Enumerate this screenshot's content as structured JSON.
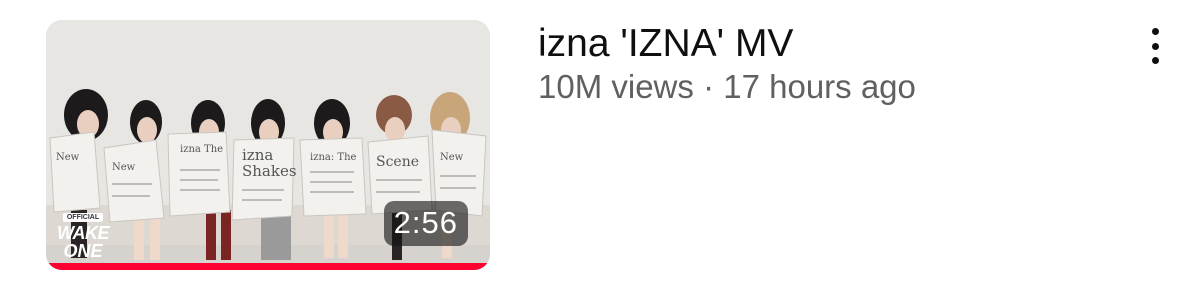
{
  "video": {
    "title": "izna 'IZNA' MV",
    "views": "10M views",
    "separator": "·",
    "posted": "17 hours ago",
    "duration": "2:56",
    "progress_fraction": 1.0,
    "progress_color": "#ff0033",
    "channel_logo": {
      "top": "OFFICIAL",
      "main": "WAKE",
      "sub": "ONE"
    },
    "thumbnail_newspaper_headline": "izna Shakes"
  },
  "icons": {
    "menu": "more-vertical-icon"
  }
}
